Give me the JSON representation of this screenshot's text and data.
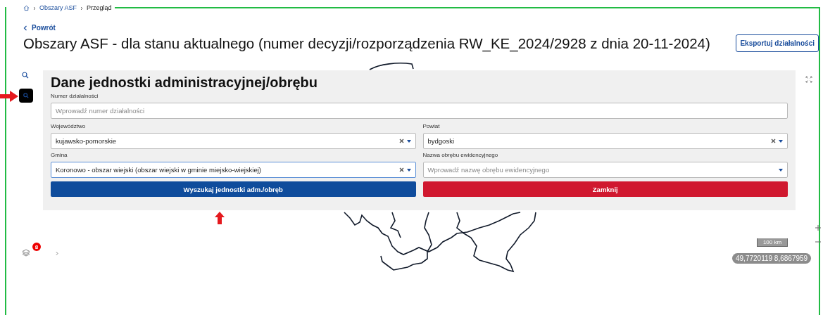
{
  "breadcrumb": [
    {
      "label": "Obszary ASF"
    },
    {
      "label": "Przegląd"
    }
  ],
  "back_link": "Powrót",
  "title": "Obszary ASF - dla stanu aktualnego (numer decyzji/rozporządzenia RW_KE_2024/2928 z dnia 20-11-2024)",
  "export_button": "Eksportuj działalności",
  "search_panel": {
    "title": "Dane jednostki administracyjnej/obrębu",
    "activity_number": {
      "label": "Numer działalności",
      "placeholder": "Wprowadź numer działalności"
    },
    "selects": [
      {
        "label": "Województwo",
        "value": "kujawsko-pomorskie",
        "clearable": true,
        "focused": false
      },
      {
        "label": "Powiat",
        "value": "bydgoski",
        "clearable": true,
        "focused": false
      },
      {
        "label": "Gmina",
        "value": "Koronowo - obszar wiejski (obszar wiejski w gminie miejsko-wiejskiej)",
        "clearable": true,
        "focused": true
      },
      {
        "label": "Nazwa obrębu ewidencyjnego",
        "placeholder": "Wprowadź nazwę obrębu ewidencyjnego",
        "clearable": false,
        "focused": false
      }
    ],
    "buttons": [
      {
        "label": "Wyszukaj jednostki adm./obręb",
        "kind": "primary"
      },
      {
        "label": "Zamknij",
        "kind": "danger"
      }
    ]
  },
  "map": {
    "layers_badge": "8",
    "scale": "100 km",
    "coordinates": "49,7720119 8,6867959"
  }
}
